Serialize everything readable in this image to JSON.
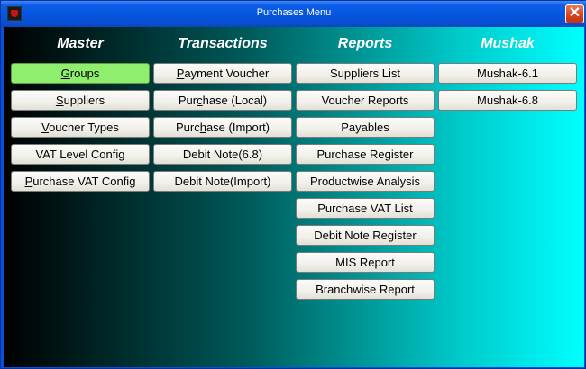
{
  "window": {
    "title": "Purchases Menu",
    "close_glyph": "✕"
  },
  "headers": {
    "master": "Master",
    "transactions": "Transactions",
    "reports": "Reports",
    "mushak": "Mushak"
  },
  "master": [
    {
      "label": "Groups",
      "pre": "",
      "ul": "G",
      "post": "roups",
      "selected": true
    },
    {
      "label": "Suppliers",
      "pre": "",
      "ul": "S",
      "post": "uppliers"
    },
    {
      "label": "Voucher Types",
      "pre": "",
      "ul": "V",
      "post": "oucher Types"
    },
    {
      "label": "VAT Level Config",
      "pre": "VAT Level Config",
      "ul": "",
      "post": ""
    },
    {
      "label": "Purchase VAT Config",
      "pre": "",
      "ul": "P",
      "post": "urchase VAT Config"
    }
  ],
  "transactions": [
    {
      "label": "Payment Voucher",
      "pre": "",
      "ul": "P",
      "post": "ayment Voucher"
    },
    {
      "label": "Purchase (Local)",
      "pre": "Pur",
      "ul": "c",
      "post": "hase (Local)"
    },
    {
      "label": "Purchase (Import)",
      "pre": "Purc",
      "ul": "h",
      "post": "ase (Import)"
    },
    {
      "label": "Debit Note(6.8)",
      "pre": "Debit Note(6.8)",
      "ul": "",
      "post": ""
    },
    {
      "label": "Debit Note(Import)",
      "pre": "Debit Note(Import)",
      "ul": "",
      "post": ""
    }
  ],
  "reports": [
    "Suppliers List",
    "Voucher Reports",
    "Payables",
    "Purchase Register",
    "Productwise Analysis",
    "Purchase VAT List",
    "Debit Note Register",
    "MIS Report",
    "Branchwise Report"
  ],
  "mushak": [
    "Mushak-6.1",
    "Mushak-6.8"
  ]
}
